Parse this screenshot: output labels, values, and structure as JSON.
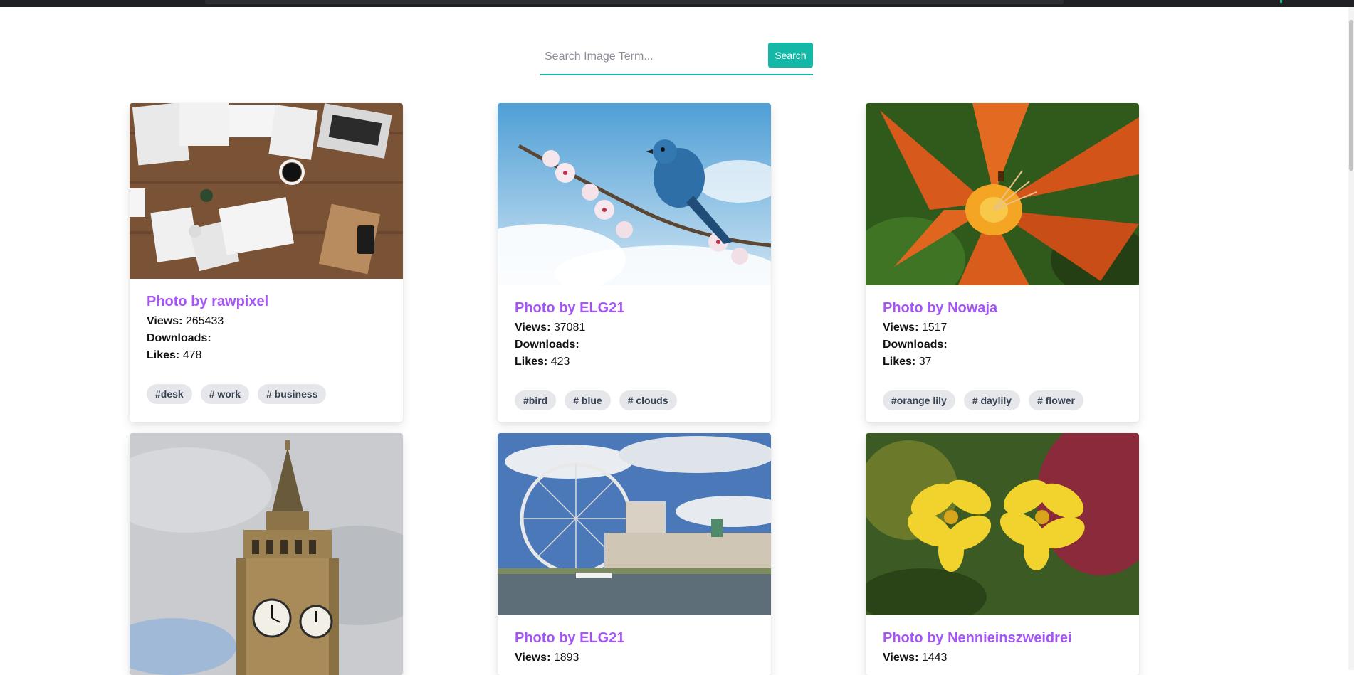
{
  "search": {
    "placeholder": "Search Image Term...",
    "button_label": "Search"
  },
  "labels": {
    "views": "Views:",
    "downloads": "Downloads:",
    "likes": "Likes:"
  },
  "cards": [
    {
      "title": "Photo by rawpixel",
      "views": "265433",
      "downloads": "",
      "likes": "478",
      "tags": [
        "#desk",
        "# work",
        "# business"
      ]
    },
    {
      "title": "Photo by ELG21",
      "views": "37081",
      "downloads": "",
      "likes": "423",
      "tags": [
        "#bird",
        "# blue",
        "# clouds"
      ]
    },
    {
      "title": "Photo by Nowaja",
      "views": "1517",
      "downloads": "",
      "likes": "37",
      "tags": [
        "#orange lily",
        "# daylily",
        "# flower"
      ]
    },
    {
      "title": "Photo by ELG21",
      "views": "1893"
    },
    {
      "title": "Photo by Nennieinszweidrei",
      "views": "1443"
    }
  ],
  "colors": {
    "accent": "#14b8a6",
    "title": "#a855f7",
    "tag_bg": "#e5e7eb"
  }
}
